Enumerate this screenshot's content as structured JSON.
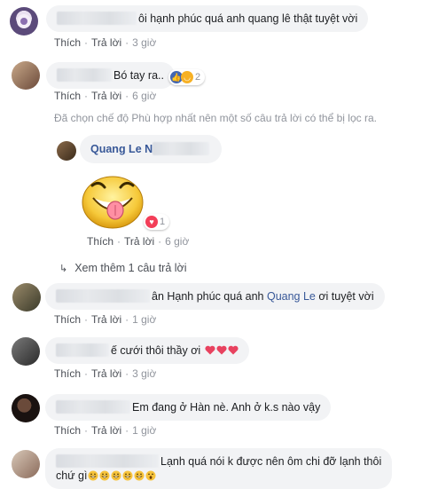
{
  "comments": [
    {
      "text": "ôi hạnh phúc quá anh quang lê thật tuyệt vời",
      "actions": {
        "like": "Thích",
        "reply": "Trả lời",
        "time": "3 giờ"
      }
    },
    {
      "text": "Bó tay ra..",
      "reaction_count": "2",
      "actions": {
        "like": "Thích",
        "reply": "Trả lời",
        "time": "6 giờ"
      }
    },
    {
      "text_pre": "ân Hạnh phúc quá anh ",
      "mention": "Quang Le",
      "text_post": " ơi tuyệt vời",
      "actions": {
        "like": "Thích",
        "reply": "Trả lời",
        "time": "1 giờ"
      }
    },
    {
      "text": "ế cưới thôi thầy ơi",
      "actions": {
        "like": "Thích",
        "reply": "Trả lời",
        "time": "3 giờ"
      }
    },
    {
      "text": "Em đang ở Hàn nè. Anh ở k.s nào vậy",
      "actions": {
        "like": "Thích",
        "reply": "Trả lời",
        "time": "1 giờ"
      }
    },
    {
      "text_line1": "Lạnh quá nói k được nên ôm chi đỡ lạnh thôi",
      "text_line2": "chứ gì"
    }
  ],
  "filter_note": "Đã chọn chế độ Phù hợp nhất nên một số câu trả lời có thể bị lọc ra.",
  "reply": {
    "author": "Quang Le",
    "author_suffix": "N",
    "reaction_count": "1",
    "actions": {
      "like": "Thích",
      "reply": "Trả lời",
      "time": "6 giờ"
    }
  },
  "more_replies": "Xem thêm 1 câu trả lời",
  "colors": {
    "link": "#385898",
    "bubble": "#f2f3f5",
    "meta": "#90949c"
  }
}
